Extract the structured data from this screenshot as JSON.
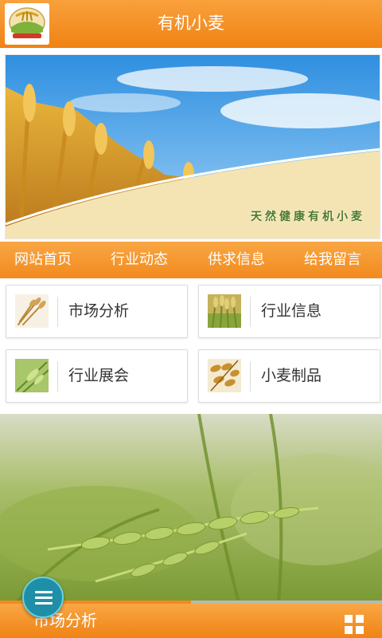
{
  "header": {
    "title": "有机小麦",
    "logo_icon": "wheat-seal-logo-icon"
  },
  "banner": {
    "caption": "天然健康有机小麦"
  },
  "nav": {
    "items": [
      {
        "label": "网站首页"
      },
      {
        "label": "行业动态"
      },
      {
        "label": "供求信息"
      },
      {
        "label": "给我留言"
      }
    ]
  },
  "categories": [
    {
      "label": "市场分析",
      "thumb_icon": "dry-wheat-icon"
    },
    {
      "label": "行业信息",
      "thumb_icon": "green-wheat-field-icon"
    },
    {
      "label": "行业展会",
      "thumb_icon": "green-wheat-closeup-icon"
    },
    {
      "label": "小麦制品",
      "thumb_icon": "wheat-grain-icon"
    }
  ],
  "bottom_bar": {
    "title": "市场分析",
    "progress": 0.5,
    "menu_icon": "hamburger-menu-icon",
    "grid_icon": "grid-view-icon"
  },
  "colors": {
    "brand_orange": "#f28a1e",
    "fab_teal": "#1f8fa8"
  }
}
